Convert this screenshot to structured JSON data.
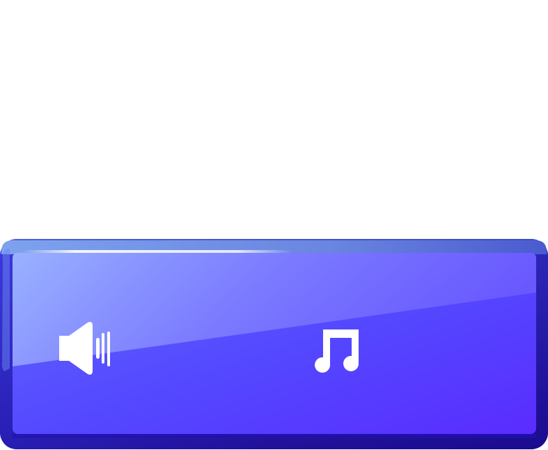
{
  "panel": {
    "colors": {
      "frame_dark": "#1a0a8c",
      "frame_light": "#5b8ae0",
      "face_top_left": "#8aa8ff",
      "face_bottom_right": "#5a2cff",
      "face_mid": "#5544ff",
      "icon": "#ffffff"
    },
    "buttons": [
      {
        "icon": "speaker-volume-icon"
      },
      {
        "icon": "music-note-icon"
      }
    ]
  }
}
